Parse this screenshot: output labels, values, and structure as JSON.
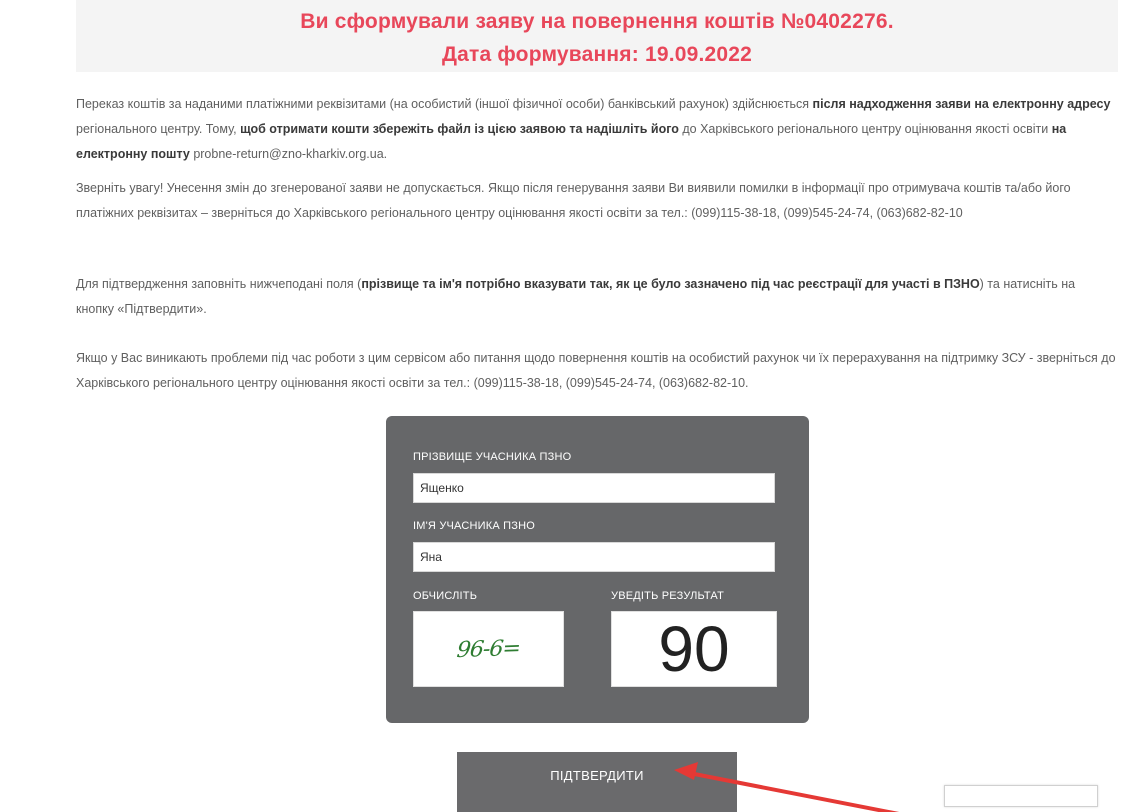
{
  "header": {
    "line1": "Ви сформували заяву на повернення коштів №0402276.",
    "line2": "Дата формування: 19.09.2022"
  },
  "paragraphs": {
    "p1": [
      {
        "text": "Переказ коштів за наданими платіжними реквізитами (на особистий (іншої фізичної особи) банківський рахунок) здійснюється ",
        "bold": false
      },
      {
        "text": "після надходження заяви на електронну адресу",
        "bold": true
      },
      {
        "text": " регіонального центру. Тому, ",
        "bold": false
      },
      {
        "text": "щоб отримати кошти збережіть файл із цією заявою та надішліть його",
        "bold": true
      },
      {
        "text": " до Харківського регіонального центру оцінювання якості освіти ",
        "bold": false
      },
      {
        "text": "на електронну пошту",
        "bold": true
      },
      {
        "text": " probne-return@zno-kharkiv.org.ua.",
        "bold": false
      }
    ],
    "p2": [
      {
        "text": "Зверніть увагу! Унесення змін до згенерованої заяви не допускається. Якщо після генерування заяви Ви виявили помилки в інформації про отримувача коштів та/або його платіжних реквізитах – зверніться до Харківського регіонального центру оцінювання якості освіти за тел.: (099)115-38-18, (099)545-24-74, (063)682-82-10",
        "bold": false
      }
    ],
    "p3": [
      {
        "text": "Для підтвердження заповніть нижчеподані поля (",
        "bold": false
      },
      {
        "text": "прізвище та ім'я потрібно вказувати так, як це було зазначено під час реєстрації для участі в ПЗНО",
        "bold": true
      },
      {
        "text": ") та натисніть на кнопку «Підтвердити».",
        "bold": false
      }
    ],
    "p4": [
      {
        "text": "Якщо у Вас виникають проблеми під час роботи з цим сервісом або питання щодо повернення коштів на особистий рахунок чи їх перерахування на підтримку ЗСУ - зверніться до Харківського регіонального центру оцінювання якості освіти за тел.: (099)115-38-18, (099)545-24-74, (063)682-82-10.",
        "bold": false
      }
    ]
  },
  "form": {
    "surname_label": "ПРІЗВИЩЕ УЧАСНИКА ПЗНО",
    "surname_value": "Ященко",
    "name_label": "ІМ'Я УЧАСНИКА ПЗНО",
    "name_value": "Яна",
    "calc_label": "ОБЧИСЛІТЬ",
    "captcha_text": "96-6=",
    "result_label": "УВЕДІТЬ РЕЗУЛЬТАТ",
    "result_value": "90",
    "panel_color": "#666769"
  },
  "confirm": {
    "label": "ПІДТВЕРДИТИ"
  },
  "colors": {
    "header_text": "#e8475a",
    "arrow": "#e53935"
  },
  "icons": {
    "arrow": "red-arrow-icon"
  }
}
